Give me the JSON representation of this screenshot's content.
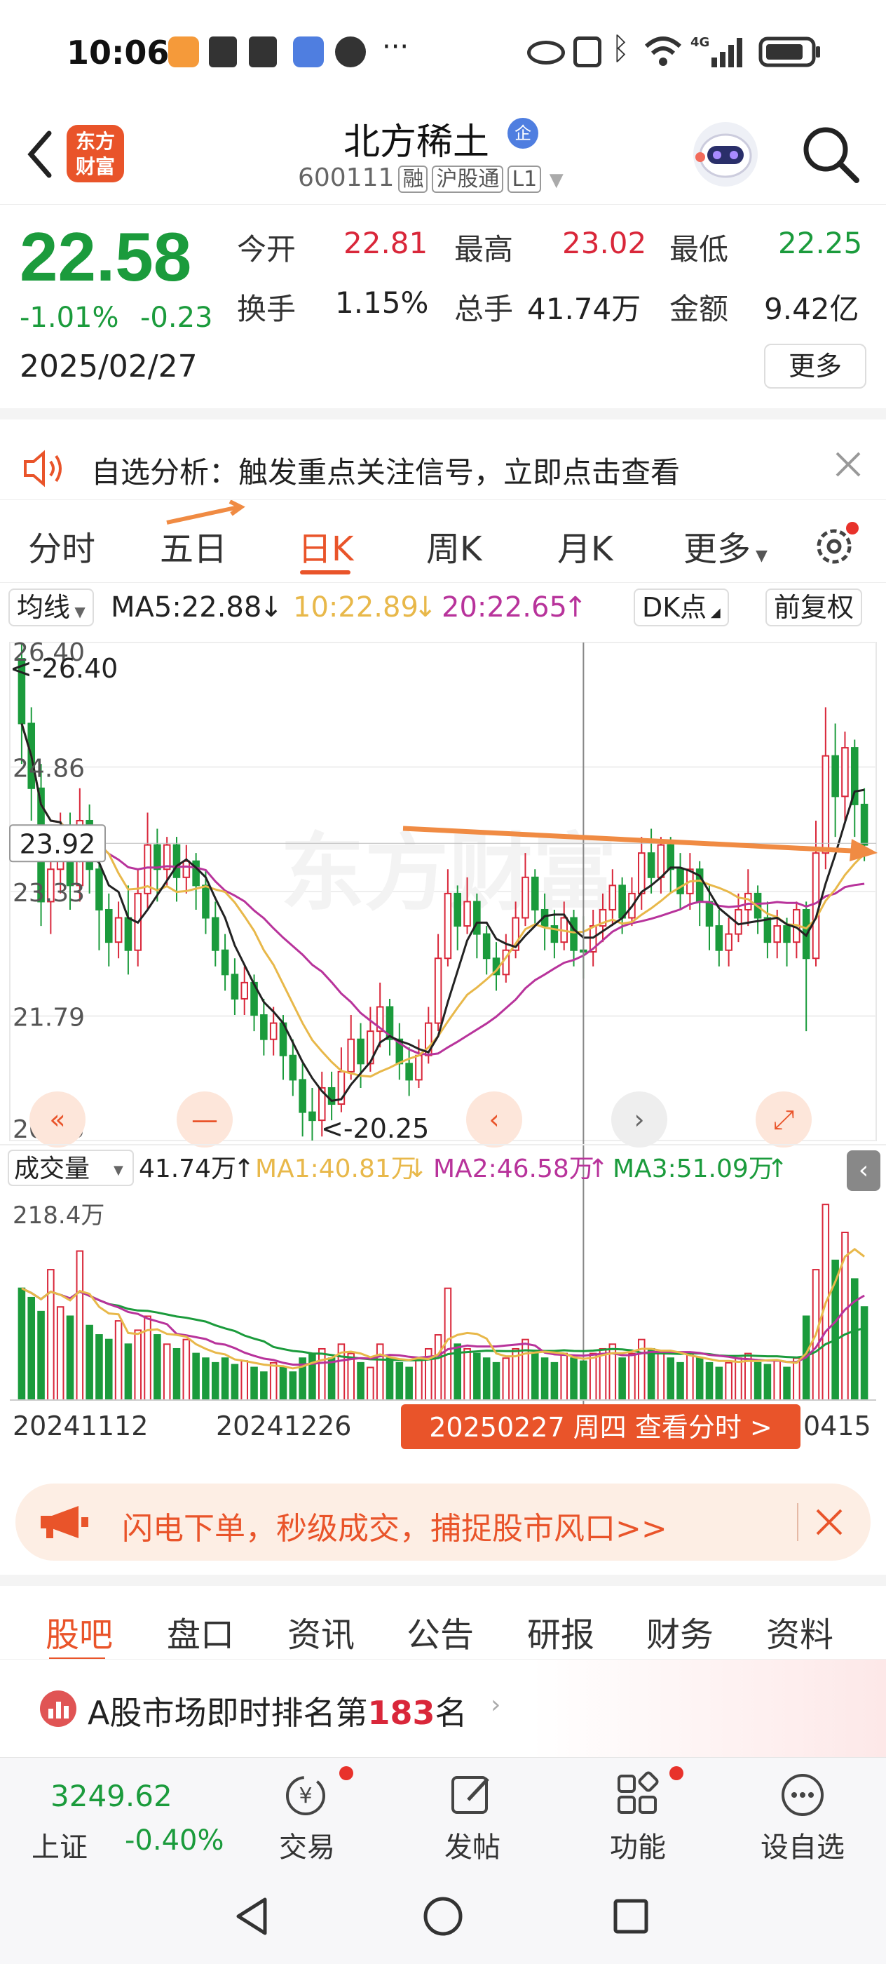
{
  "status_bar": {
    "time": "10:06",
    "network": "4G"
  },
  "header": {
    "logo_text_1": "东方",
    "logo_text_2": "财富",
    "stock_name": "北方稀土",
    "enterprise_badge": "企",
    "stock_code": "600111",
    "tags": [
      "融",
      "沪股通",
      "L1"
    ]
  },
  "quote": {
    "price": "22.58",
    "change_pct": "-1.01%",
    "change": "-0.23",
    "date": "2025/02/27",
    "open_label": "今开",
    "open": "22.81",
    "high_label": "最高",
    "high": "23.02",
    "low_label": "最低",
    "low": "22.25",
    "turnover_label": "换手",
    "turnover": "1.15%",
    "volume_label": "总手",
    "volume": "41.74万",
    "amount_label": "金额",
    "amount": "9.42亿",
    "more_label": "更多",
    "colors": {
      "down": "#1b9b3c",
      "up": "#d9273a"
    }
  },
  "alert": {
    "text": "自选分析：触发重点关注信号，立即点击查看"
  },
  "chart_tabs": {
    "items": [
      "分时",
      "五日",
      "日K",
      "周K",
      "月K",
      "更多"
    ],
    "active": "日K"
  },
  "ma_bar": {
    "selector": "均线",
    "ma5": "MA5:22.88",
    "ma10": "10:22.89",
    "ma20": "20:22.65",
    "dk_button": "DK点",
    "adjust_button": "前复权"
  },
  "chart_data": {
    "type": "candlestick",
    "watermark": "东方财富",
    "price_axis_labels": [
      "26.40",
      "24.86",
      "23.33",
      "21.79",
      "20.25"
    ],
    "crosshair_price": "23.92",
    "max_marker": "<-26.40",
    "min_marker": "<-20.25",
    "ylim": [
      20.25,
      26.4
    ],
    "candles": [
      [
        26.2,
        25.4,
        26.4,
        24.9
      ],
      [
        25.4,
        24.6,
        25.6,
        24.2
      ],
      [
        24.6,
        23.2,
        24.9,
        22.9
      ],
      [
        23.2,
        23.6,
        24.0,
        22.8
      ],
      [
        23.6,
        24.1,
        24.3,
        23.3
      ],
      [
        24.1,
        23.4,
        24.3,
        23.1
      ],
      [
        23.4,
        24.2,
        24.6,
        23.2
      ],
      [
        24.2,
        23.6,
        24.4,
        23.3
      ],
      [
        23.6,
        23.1,
        23.9,
        22.6
      ],
      [
        23.1,
        22.7,
        23.3,
        22.4
      ],
      [
        22.7,
        23.0,
        23.2,
        22.5
      ],
      [
        23.0,
        22.6,
        23.4,
        22.3
      ],
      [
        22.6,
        23.3,
        23.6,
        22.4
      ],
      [
        23.3,
        23.9,
        24.3,
        23.1
      ],
      [
        23.9,
        23.6,
        24.1,
        23.2
      ],
      [
        23.6,
        23.9,
        24.0,
        23.4
      ],
      [
        23.9,
        23.5,
        24.0,
        23.2
      ],
      [
        23.5,
        23.7,
        23.9,
        23.3
      ],
      [
        23.7,
        23.4,
        23.8,
        23.1
      ],
      [
        23.4,
        23.0,
        23.6,
        22.8
      ],
      [
        23.0,
        22.6,
        23.2,
        22.4
      ],
      [
        22.6,
        22.3,
        22.8,
        22.1
      ],
      [
        22.3,
        22.0,
        22.5,
        21.8
      ],
      [
        22.0,
        22.2,
        22.4,
        21.8
      ],
      [
        22.2,
        21.8,
        22.3,
        21.6
      ],
      [
        21.8,
        21.5,
        22.0,
        21.3
      ],
      [
        21.5,
        21.7,
        21.9,
        21.3
      ],
      [
        21.7,
        21.3,
        21.8,
        21.0
      ],
      [
        21.3,
        21.0,
        21.5,
        20.8
      ],
      [
        21.0,
        20.6,
        21.2,
        20.3
      ],
      [
        20.6,
        20.5,
        20.9,
        20.25
      ],
      [
        20.5,
        20.9,
        21.1,
        20.3
      ],
      [
        20.9,
        20.7,
        21.1,
        20.5
      ],
      [
        20.7,
        21.1,
        21.4,
        20.6
      ],
      [
        21.1,
        21.5,
        21.8,
        21.0
      ],
      [
        21.5,
        21.2,
        21.7,
        20.9
      ],
      [
        21.2,
        21.6,
        21.9,
        21.1
      ],
      [
        21.6,
        21.9,
        22.2,
        21.4
      ],
      [
        21.9,
        21.5,
        22.0,
        21.3
      ],
      [
        21.5,
        21.2,
        21.7,
        21.0
      ],
      [
        21.2,
        21.0,
        21.4,
        20.8
      ],
      [
        21.0,
        21.3,
        21.5,
        20.9
      ],
      [
        21.3,
        21.7,
        21.9,
        21.2
      ],
      [
        21.7,
        22.5,
        22.8,
        21.6
      ],
      [
        22.5,
        23.3,
        23.6,
        22.4
      ],
      [
        23.3,
        22.9,
        23.4,
        22.6
      ],
      [
        22.9,
        23.2,
        23.5,
        22.8
      ],
      [
        23.2,
        22.8,
        23.3,
        22.5
      ],
      [
        22.8,
        22.5,
        22.9,
        22.3
      ],
      [
        22.5,
        22.3,
        22.7,
        22.1
      ],
      [
        22.3,
        22.6,
        22.8,
        22.2
      ],
      [
        22.6,
        23.0,
        23.2,
        22.5
      ],
      [
        23.0,
        23.5,
        23.8,
        22.9
      ],
      [
        23.5,
        23.1,
        23.6,
        22.9
      ],
      [
        23.1,
        22.9,
        23.3,
        22.6
      ],
      [
        22.9,
        22.7,
        23.1,
        22.5
      ],
      [
        22.7,
        23.0,
        23.2,
        22.6
      ],
      [
        23.0,
        22.6,
        23.1,
        22.4
      ],
      [
        22.6,
        22.58,
        23.02,
        22.25
      ],
      [
        22.58,
        22.9,
        23.1,
        22.4
      ],
      [
        22.9,
        23.1,
        23.3,
        22.7
      ],
      [
        23.1,
        23.4,
        23.6,
        22.9
      ],
      [
        23.4,
        23.0,
        23.5,
        22.8
      ],
      [
        23.0,
        23.3,
        23.5,
        22.9
      ],
      [
        23.3,
        23.8,
        24.0,
        23.1
      ],
      [
        23.8,
        23.5,
        24.1,
        23.3
      ],
      [
        23.5,
        23.9,
        24.0,
        23.3
      ],
      [
        23.9,
        23.6,
        24.0,
        23.3
      ],
      [
        23.6,
        23.3,
        23.8,
        23.1
      ],
      [
        23.3,
        23.6,
        23.8,
        23.1
      ],
      [
        23.6,
        23.2,
        23.7,
        22.9
      ],
      [
        23.2,
        22.9,
        23.4,
        22.6
      ],
      [
        22.9,
        22.6,
        23.1,
        22.4
      ],
      [
        22.6,
        22.8,
        23.0,
        22.4
      ],
      [
        22.8,
        23.1,
        23.3,
        22.7
      ],
      [
        23.1,
        23.3,
        23.6,
        22.9
      ],
      [
        23.3,
        23.0,
        23.4,
        22.8
      ],
      [
        23.0,
        22.7,
        23.2,
        22.5
      ],
      [
        22.7,
        22.9,
        23.1,
        22.5
      ],
      [
        22.9,
        22.7,
        23.0,
        22.4
      ],
      [
        22.7,
        23.1,
        23.2,
        22.5
      ],
      [
        23.1,
        22.5,
        23.2,
        21.6
      ],
      [
        22.5,
        23.8,
        24.2,
        22.4
      ],
      [
        23.8,
        25.0,
        25.6,
        23.6
      ],
      [
        25.0,
        24.5,
        25.4,
        24.0
      ],
      [
        24.5,
        25.1,
        25.3,
        24.2
      ],
      [
        25.1,
        24.4,
        25.2,
        24.0
      ],
      [
        24.4,
        23.9,
        24.6,
        23.7
      ]
    ],
    "volume_bar": {
      "selector": "成交量",
      "current": "41.74万",
      "ma1": "MA1:40.81万",
      "ma2": "MA2:46.58万",
      "ma3": "MA3:51.09万",
      "max_label": "218.4万"
    },
    "volumes": [
      120,
      110,
      95,
      140,
      100,
      90,
      160,
      80,
      70,
      65,
      85,
      60,
      75,
      90,
      70,
      60,
      55,
      65,
      50,
      45,
      40,
      45,
      38,
      42,
      35,
      30,
      40,
      35,
      30,
      45,
      50,
      55,
      45,
      60,
      50,
      40,
      35,
      60,
      45,
      40,
      35,
      45,
      55,
      70,
      120,
      60,
      55,
      50,
      45,
      40,
      45,
      55,
      65,
      50,
      45,
      40,
      50,
      45,
      41.74,
      50,
      55,
      60,
      45,
      50,
      65,
      55,
      50,
      45,
      40,
      50,
      45,
      40,
      35,
      40,
      45,
      50,
      40,
      38,
      42,
      35,
      45,
      90,
      140,
      210,
      150,
      180,
      130,
      100
    ],
    "date_labels": [
      "20241112",
      "20241226",
      "0415"
    ],
    "tooltip": "20250227 周四 查看分时 >"
  },
  "banner": {
    "text": "闪电下单，秒级成交，捕捉股市风口>>"
  },
  "bottom_tabs": {
    "items": [
      "股吧",
      "盘口",
      "资讯",
      "公告",
      "研报",
      "财务",
      "资料"
    ],
    "active": "股吧"
  },
  "rank": {
    "prefix": "A股市场即时排名第",
    "number": "183",
    "suffix": "名"
  },
  "bottom_nav": {
    "index_value": "3249.62",
    "index_name": "上证",
    "index_change": "-0.40%",
    "items": [
      "交易",
      "发帖",
      "功能",
      "设自选"
    ]
  }
}
